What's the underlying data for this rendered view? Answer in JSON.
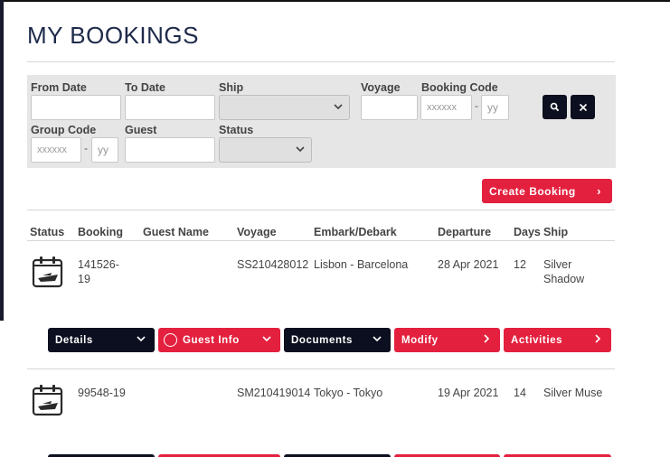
{
  "page": {
    "title": "MY BOOKINGS"
  },
  "filters": {
    "from_date_label": "From Date",
    "to_date_label": "To Date",
    "ship_label": "Ship",
    "voyage_label": "Voyage",
    "booking_code_label": "Booking Code",
    "booking_code_placeholder": "xxxxxx",
    "booking_code_yy": "yy",
    "group_code_label": "Group Code",
    "group_code_placeholder": "xxxxxx",
    "group_code_yy": "yy",
    "guest_label": "Guest",
    "status_label": "Status",
    "dash": "-",
    "search_icon": "search-icon",
    "clear_icon": "close-icon"
  },
  "actions": {
    "create_booking": "Create Booking"
  },
  "table": {
    "headers": [
      "Status",
      "Booking",
      "Guest Name",
      "Voyage",
      "Embark/Debark",
      "Departure",
      "Days",
      "Ship"
    ],
    "rows": [
      {
        "booking_line1": "141526-",
        "booking_line2": "19",
        "voyage": "SS210428012",
        "embark_debark": "Lisbon - Barcelona",
        "departure": "28 Apr 2021",
        "days": "12",
        "ship_line1": "Silver",
        "ship_line2": "Shadow"
      },
      {
        "booking": "99548-19",
        "voyage": "SM210419014",
        "embark_debark": "Tokyo - Tokyo",
        "departure": "19 Apr 2021",
        "days": "14",
        "ship": "Silver Muse"
      }
    ]
  },
  "row_actions": {
    "details": "Details",
    "guest_info": "Guest Info",
    "documents": "Documents",
    "modify": "Modify",
    "activities": "Activities"
  },
  "colors": {
    "accent_red": "#e3203e",
    "dark_navy": "#0c0f1f",
    "title_navy": "#1e2a4a",
    "panel_grey": "#e6e6e6"
  }
}
